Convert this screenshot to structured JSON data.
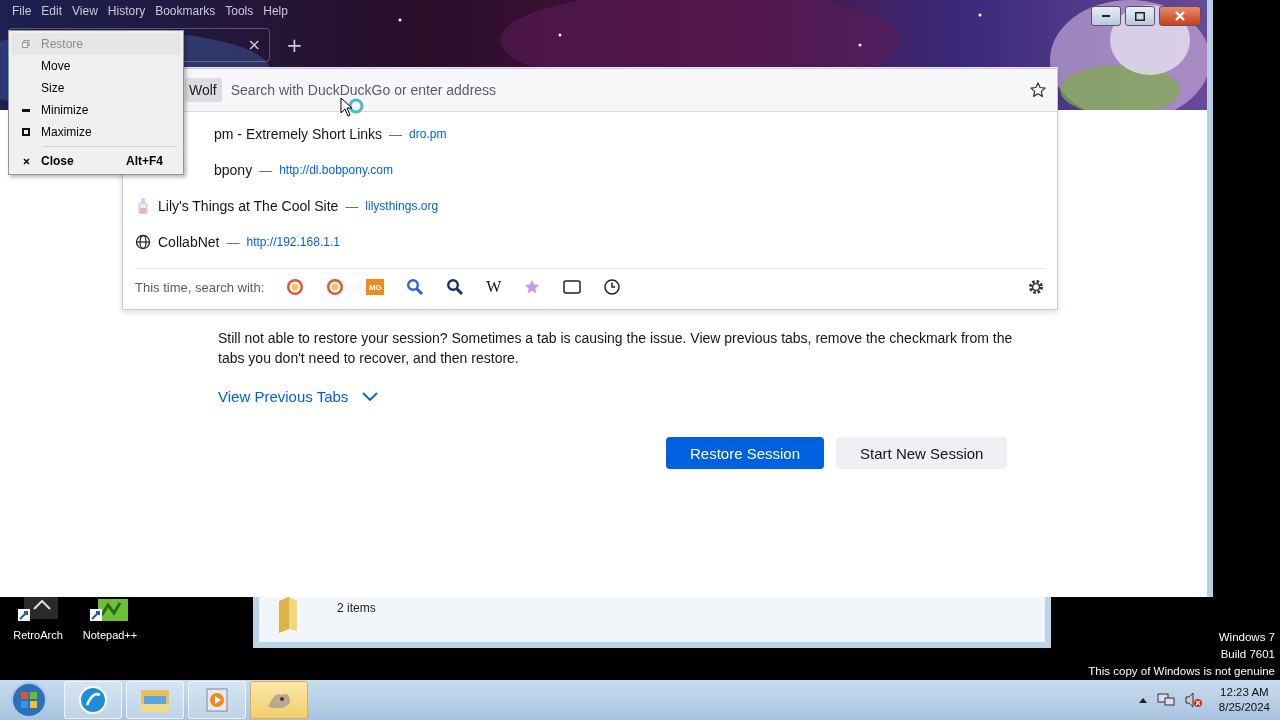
{
  "browser": {
    "menu_bar": [
      "File",
      "Edit",
      "View",
      "History",
      "Bookmarks",
      "Tools",
      "Help"
    ],
    "tab": {
      "close": "×"
    },
    "new_tab": "+",
    "identity": "Wolf",
    "address": {
      "placeholder": "Search with DuckDuckGo or enter address"
    },
    "suggestions": [
      {
        "kind": "covered",
        "title": "pm - Extremely Short Links",
        "separator": "—",
        "url": "dro.pm"
      },
      {
        "kind": "covered",
        "title": "bpony",
        "separator": "—",
        "url": "http://dl.bobpony.com"
      },
      {
        "kind": "bottle",
        "title": "Lily's Things at The Cool Site",
        "separator": "—",
        "url": "lilysthings.org"
      },
      {
        "kind": "globe",
        "title": "CollabNet",
        "separator": "—",
        "url": "http://192.168.1.1"
      }
    ],
    "search_with": {
      "label": "This time, search with:",
      "engines": [
        {
          "kind": "duck"
        },
        {
          "kind": "duck"
        },
        {
          "kind": "tile",
          "glyph": "MG"
        },
        {
          "kind": "magnifier"
        },
        {
          "kind": "magnifier-dark"
        },
        {
          "kind": "letter",
          "glyph": "W"
        },
        {
          "kind": "star"
        },
        {
          "kind": "tabs"
        },
        {
          "kind": "history"
        }
      ]
    },
    "page": {
      "paragraph": "Still not able to restore your session? Sometimes a tab is causing the issue. View previous tabs, remove the checkmark from the tabs you don't need to recover, and then restore.",
      "toggle": {
        "label": "View Previous Tabs",
        "expanded": false
      },
      "buttons": [
        {
          "label": "Restore Session",
          "primary": true
        },
        {
          "label": "Start New Session",
          "primary": false
        }
      ]
    },
    "system_menu": [
      {
        "kind": "restore",
        "label": "Restore",
        "disabled": true,
        "default": false,
        "separator_before": false
      },
      {
        "kind": "plain",
        "label": "Move",
        "disabled": false,
        "default": false,
        "separator_before": false
      },
      {
        "kind": "plain",
        "label": "Size",
        "disabled": false,
        "default": false,
        "separator_before": false
      },
      {
        "kind": "minimize",
        "label": "Minimize",
        "disabled": false,
        "default": false,
        "separator_before": false
      },
      {
        "kind": "maximize",
        "label": "Maximize",
        "disabled": false,
        "default": false,
        "separator_before": false
      },
      {
        "kind": "close",
        "label": "Close",
        "shortcut": "Alt+F4",
        "disabled": false,
        "default": true,
        "separator_before": true
      }
    ]
  },
  "desktop": {
    "icons": [
      {
        "kind": "retroarch",
        "label": "RetroArch"
      },
      {
        "kind": "notepad",
        "label": "Notepad++"
      }
    ],
    "explorer": {
      "status": "2 items"
    },
    "watermark": [
      "Windows 7",
      "Build 7601",
      "This copy of Windows is not genuine"
    ]
  },
  "taskbar": {
    "items": [
      {
        "kind": "browser",
        "selected": false
      },
      {
        "kind": "folders",
        "selected": false
      },
      {
        "kind": "player",
        "selected": false
      },
      {
        "kind": "paint",
        "selected": true
      }
    ],
    "clock": {
      "time": "12:23 AM",
      "date": "8/25/2024"
    }
  }
}
